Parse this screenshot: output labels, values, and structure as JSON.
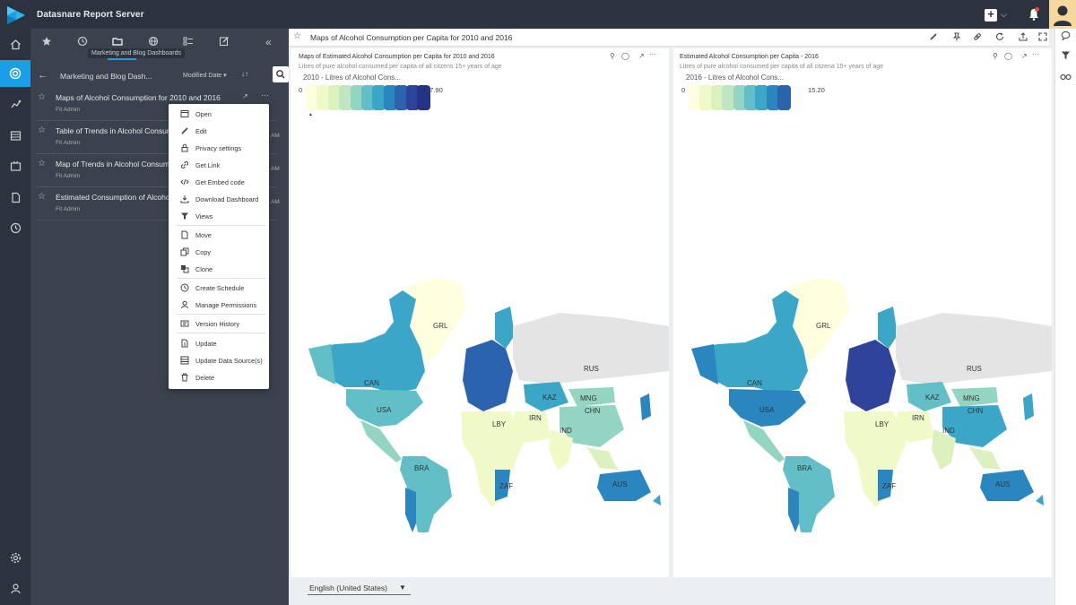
{
  "app": {
    "title": "Datasnare Report Server"
  },
  "panel": {
    "tooltip": "Marketing and Blog Dashboards",
    "folder_title": "Marketing and Blog Dash...",
    "sort_label": "Modified Date",
    "items": [
      {
        "title": "Maps of Alcohol Consumption for 2010 and 2016",
        "author": "Fit Admin",
        "time": ""
      },
      {
        "title": "Table of Trends in Alcohol Consumption",
        "author": "Fit Admin",
        "time": "AM"
      },
      {
        "title": "Map of Trends in Alcohol Consumption",
        "author": "Fit Admin",
        "time": "AM"
      },
      {
        "title": "Estimated Consumption of Alcohol",
        "author": "Fit Admin",
        "time": "AM"
      }
    ]
  },
  "context_menu": {
    "items": [
      "Open",
      "Edit",
      "Privacy settings",
      "Get Link",
      "Get Embed code",
      "Download Dashboard",
      "Views",
      "Move",
      "Copy",
      "Clone",
      "Create Schedule",
      "Manage Permissions",
      "Version History",
      "Update",
      "Update Data Source(s)",
      "Delete"
    ]
  },
  "dashboard": {
    "title": "Maps of Alcohol Consumption per Capita for 2010 and 2016"
  },
  "widgets": [
    {
      "title": "Maps of Estimated Alcohol Consumption per Capita for 2010 and 2016",
      "subtitle": "Litres of pure alcohol consumed per capita of all citzens 15+ years of age",
      "legend_title": "2010 - Litres of Alcohol Cons...",
      "legend_min": "0",
      "legend_max": "17.90"
    },
    {
      "title": "Estimated Alcohol Consumption per Capita - 2016",
      "subtitle": "Litres of pure alcohol consumed per capita of all citzena 15+ years of age",
      "legend_title": "2016 - Litres of Alcohol Cons...",
      "legend_min": "0",
      "legend_max": "15.20"
    }
  ],
  "map_labels": [
    "GRL",
    "RUS",
    "CAN",
    "KAZ",
    "MNG",
    "USA",
    "CHN",
    "LBY",
    "IRN",
    "IND",
    "BRA",
    "ZAF",
    "AUS"
  ],
  "legend_colors": [
    "#ffffe0",
    "#f0f9c8",
    "#dcf1bd",
    "#bfe6c0",
    "#93d4c3",
    "#62bfc7",
    "#3ba6c8",
    "#2b85bf",
    "#2c63ae",
    "#2e449a",
    "#253385"
  ],
  "colors": {
    "accent": "#1a9ee6",
    "chrome": "#2c333f",
    "panel": "#3b424d"
  },
  "language": {
    "selected": "English (United States)"
  }
}
